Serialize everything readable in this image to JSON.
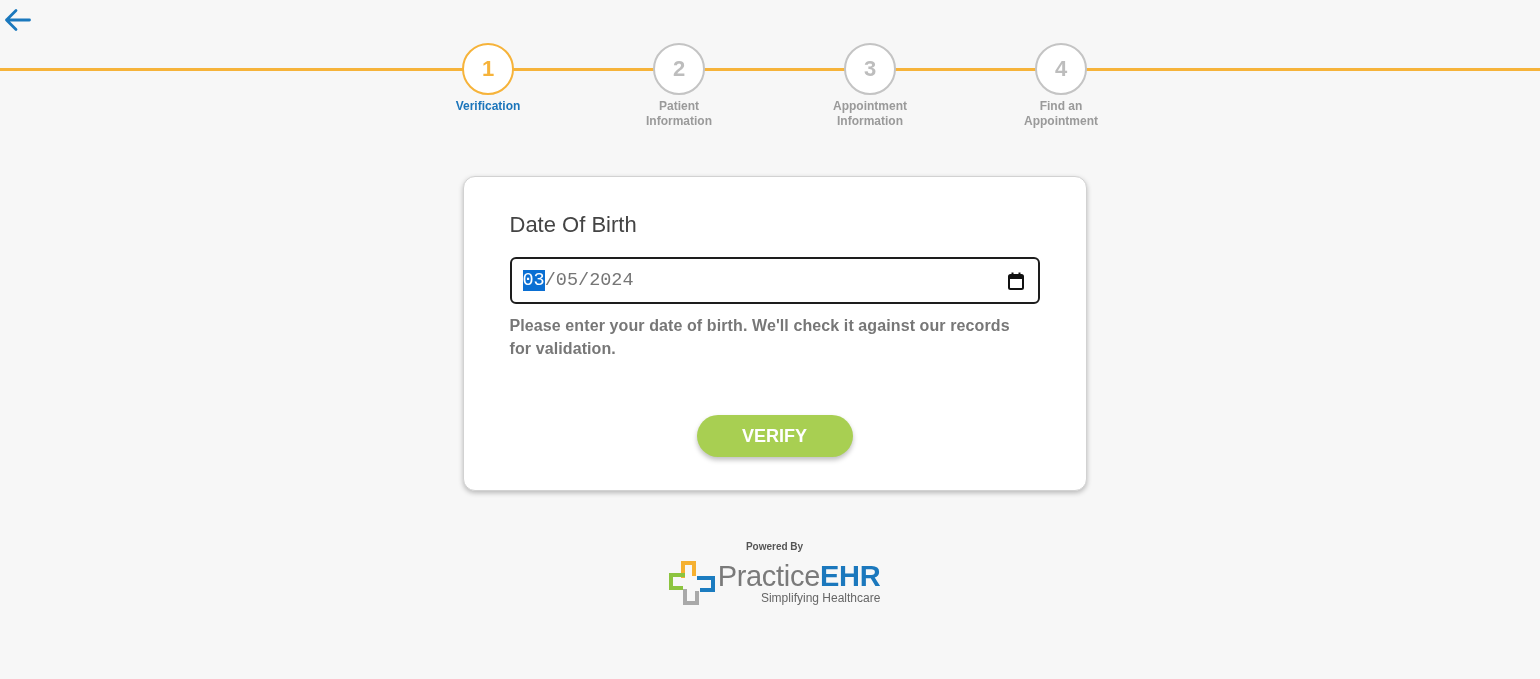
{
  "steps": [
    {
      "number": "1",
      "label": "Verification",
      "selected": true
    },
    {
      "number": "2",
      "label": "Patient Information",
      "selected": false
    },
    {
      "number": "3",
      "label": "Appointment Information",
      "selected": false
    },
    {
      "number": "4",
      "label": "Find an Appointment",
      "selected": false
    }
  ],
  "form": {
    "title": "Date Of Birth",
    "date_field": {
      "segments": [
        {
          "text": "03",
          "selected": true
        },
        {
          "text": "05",
          "selected": false
        },
        {
          "text": "2024",
          "selected": false
        }
      ],
      "separators": [
        "/",
        "/"
      ]
    },
    "helper_text": "Please enter your date of birth. We'll check it against our records for validation.",
    "button": "VERIFY"
  },
  "footer": {
    "powered_by": "Powered By",
    "brand": "Practice**EHR**",
    "tagline": "Simplifying Healthcare"
  }
}
